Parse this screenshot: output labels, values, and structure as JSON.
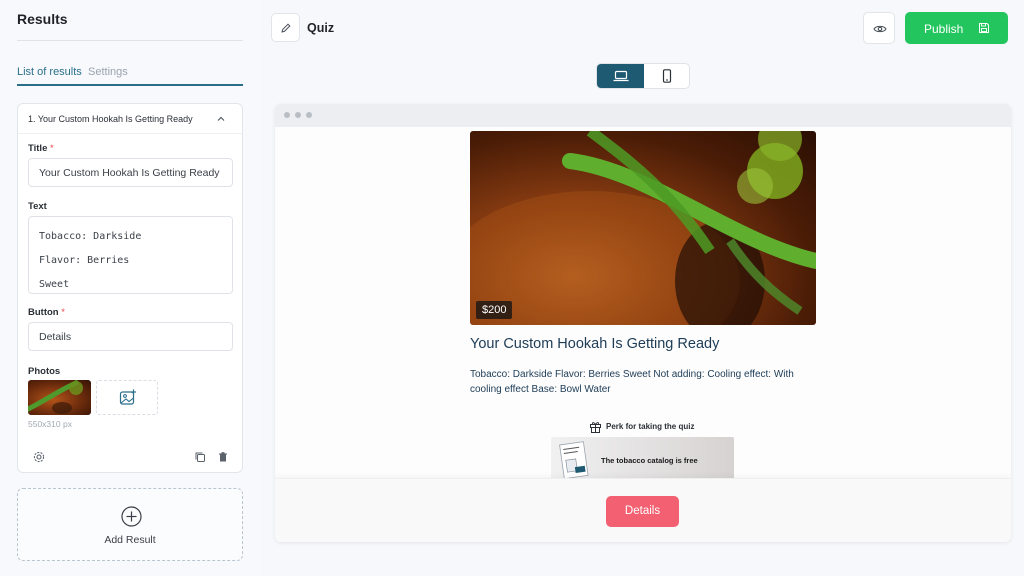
{
  "sidebar": {
    "title": "Results",
    "tabs": [
      {
        "label": "List of results",
        "active": true
      },
      {
        "label": "Settings",
        "active": false
      }
    ],
    "result_card": {
      "header": "1. Your Custom Hookah Is Getting Ready",
      "title_label": "Title",
      "title_value": "Your Custom Hookah Is Getting Ready",
      "text_label": "Text",
      "text_lines": [
        "Tobacco: Darkside",
        "Flavor: Berries",
        "Sweet"
      ],
      "button_label": "Button",
      "button_value": "Details",
      "photos_label": "Photos",
      "photo_dimensions": "550x310 px",
      "required_mark": "*"
    },
    "add_result_label": "Add Result"
  },
  "header": {
    "quiz_title": "Quiz",
    "publish_label": "Publish"
  },
  "preview": {
    "price": "$200",
    "result_title": "Your Custom Hookah Is Getting Ready",
    "result_text": "Tobacco: Darkside Flavor: Berries Sweet Not adding: Cooling effect: With cooling effect Base: Bowl Water",
    "perk_label": "Perk for taking the quiz",
    "perk_card_text": "The tobacco catalog is free",
    "details_button": "Details"
  },
  "colors": {
    "accent": "#2a6f8a",
    "publish": "#22c55e",
    "device_active": "#1f5a73",
    "details_button": "#f26071",
    "required": "#e5484d"
  },
  "icons": [
    "pencil-icon",
    "eye-icon",
    "save-icon",
    "laptop-icon",
    "phone-icon",
    "chevron-up-icon",
    "image-add-icon",
    "gear-icon",
    "copy-icon",
    "trash-icon",
    "plus-circle-icon",
    "gift-icon"
  ]
}
